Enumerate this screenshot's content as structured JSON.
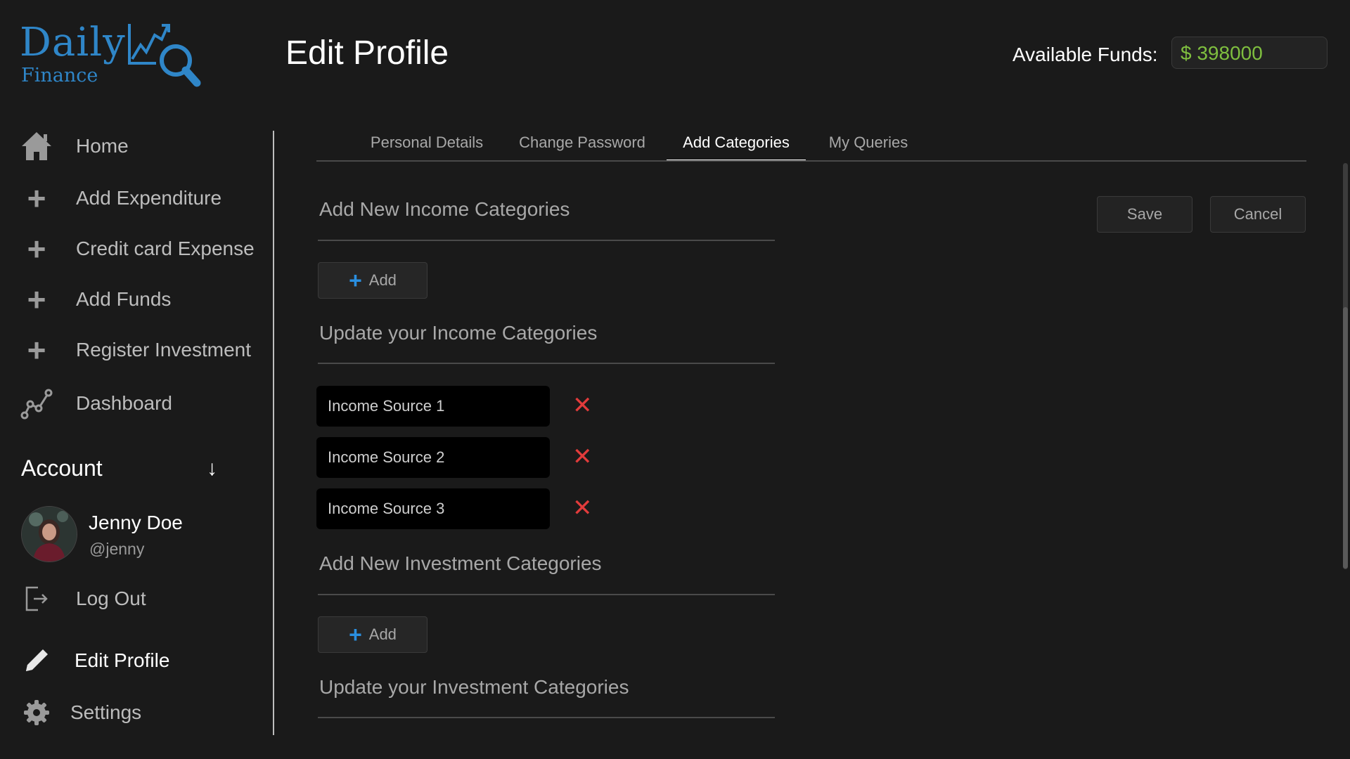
{
  "logo": {
    "line1": "Daily",
    "line2": "Finance",
    "accent": "#2f86c8"
  },
  "header": {
    "title": "Edit Profile",
    "funds_label": "Available Funds:",
    "funds_value": "$ 398000",
    "funds_color": "#7fbf3f"
  },
  "sidebar": {
    "items": [
      {
        "label": "Home",
        "icon": "home-icon"
      },
      {
        "label": "Add Expenditure",
        "icon": "plus-icon"
      },
      {
        "label": "Credit card Expense",
        "icon": "plus-icon"
      },
      {
        "label": "Add Funds",
        "icon": "plus-icon"
      },
      {
        "label": "Register Investment",
        "icon": "plus-icon"
      },
      {
        "label": "Dashboard",
        "icon": "graph-icon"
      }
    ],
    "account_heading": "Account",
    "user": {
      "name": "Jenny Doe",
      "handle": "@jenny"
    },
    "logout": {
      "label": "Log Out",
      "icon": "logout-icon"
    },
    "edit_profile": {
      "label": "Edit Profile",
      "icon": "pencil-icon"
    },
    "settings": {
      "label": "Settings",
      "icon": "gear-icon"
    }
  },
  "tabs": [
    {
      "label": "Personal Details",
      "active": false
    },
    {
      "label": "Change Password",
      "active": false
    },
    {
      "label": "Add Categories",
      "active": true
    },
    {
      "label": "My Queries",
      "active": false
    }
  ],
  "actions": {
    "save": "Save",
    "cancel": "Cancel"
  },
  "income": {
    "add_title": "Add New Income Categories",
    "add_button": "Add",
    "update_title": "Update your Income Categories",
    "categories": [
      "Income Source 1",
      "Income Source 2",
      "Income Source 3"
    ]
  },
  "investment": {
    "add_title": "Add New Investment Categories",
    "add_button": "Add",
    "update_title": "Update your Investment Categories"
  },
  "colors": {
    "background": "#1a1a1a",
    "remove": "#e23b3b",
    "add_plus": "#2a8fe0"
  }
}
